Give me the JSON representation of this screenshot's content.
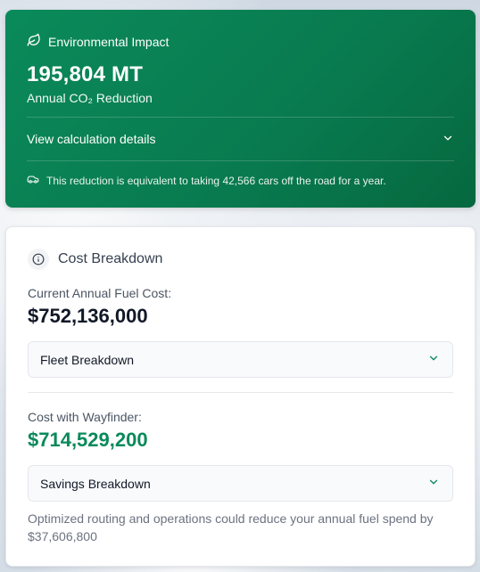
{
  "environmental": {
    "header": "Environmental Impact",
    "icon": "leaf-icon",
    "value": "195,804 MT",
    "subtitle": "Annual CO₂ Reduction",
    "details_label": "View calculation details",
    "note": "This reduction is equivalent to taking 42,566 cars off the road for a year.",
    "colors": {
      "background": "#0a8a5a",
      "text": "#ffffff"
    }
  },
  "cost": {
    "title": "Cost Breakdown",
    "current_label": "Current Annual Fuel Cost:",
    "current_value": "$752,136,000",
    "fleet_dropdown": "Fleet Breakdown",
    "wayfinder_label": "Cost with Wayfinder:",
    "wayfinder_value": "$714,529,200",
    "savings_dropdown": "Savings Breakdown",
    "summary": "Optimized routing and operations could reduce your annual fuel spend by $37,606,800",
    "colors": {
      "accent": "#0a8a5a"
    }
  }
}
